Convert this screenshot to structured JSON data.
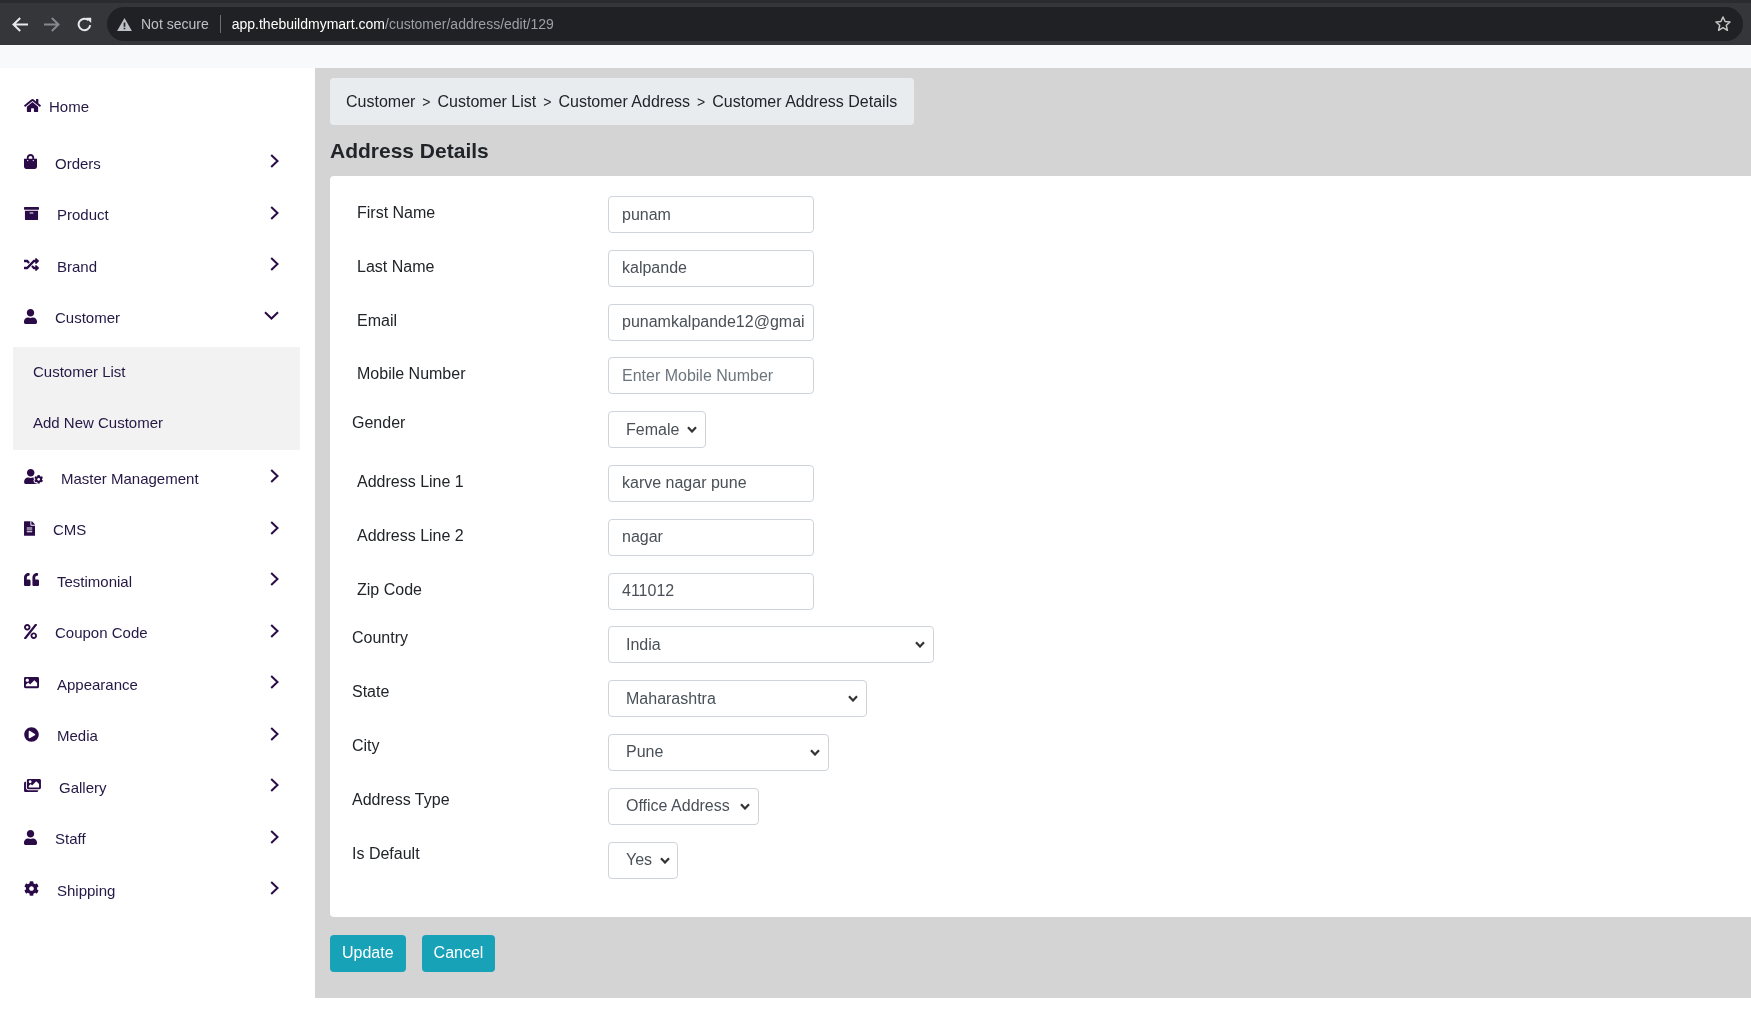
{
  "browser": {
    "security_label": "Not secure",
    "url": {
      "host": "app.thebuildmymart.com",
      "path": "/customer/address/edit/129"
    }
  },
  "sidebar": {
    "items": [
      {
        "label": "Home",
        "kind": "link"
      },
      {
        "label": "Orders",
        "kind": "group",
        "expanded": false
      },
      {
        "label": "Product",
        "kind": "group",
        "expanded": false
      },
      {
        "label": "Brand",
        "kind": "group",
        "expanded": false
      },
      {
        "label": "Customer",
        "kind": "group",
        "expanded": true,
        "children": [
          {
            "label": "Customer List"
          },
          {
            "label": "Add New Customer"
          }
        ]
      },
      {
        "label": "Master Management",
        "kind": "group",
        "expanded": false
      },
      {
        "label": "CMS",
        "kind": "group",
        "expanded": false
      },
      {
        "label": "Testimonial",
        "kind": "group",
        "expanded": false
      },
      {
        "label": "Coupon Code",
        "kind": "group",
        "expanded": false
      },
      {
        "label": "Appearance",
        "kind": "group",
        "expanded": false
      },
      {
        "label": "Media",
        "kind": "group",
        "expanded": false
      },
      {
        "label": "Gallery",
        "kind": "group",
        "expanded": false
      },
      {
        "label": "Staff",
        "kind": "group",
        "expanded": false
      },
      {
        "label": "Shipping",
        "kind": "group",
        "expanded": false
      }
    ]
  },
  "breadcrumb": {
    "items": [
      "Customer",
      "Customer List",
      "Customer Address",
      "Customer Address Details"
    ],
    "separator": ">"
  },
  "page_title": "Address Details",
  "form": {
    "fields": [
      {
        "label": "First Name",
        "kind": "text",
        "value": "punam"
      },
      {
        "label": "Last Name",
        "kind": "text",
        "value": "kalpande"
      },
      {
        "label": "Email",
        "kind": "text",
        "value": "punamkalpande12@gmai"
      },
      {
        "label": "Mobile Number",
        "kind": "text",
        "placeholder": "Enter Mobile Number"
      },
      {
        "label": "Gender",
        "kind": "select",
        "value": "Female"
      },
      {
        "label": "Address Line 1",
        "kind": "text",
        "value": "karve nagar pune"
      },
      {
        "label": "Address Line 2",
        "kind": "text",
        "value": "nagar"
      },
      {
        "label": "Zip Code",
        "kind": "text",
        "value": "411012"
      },
      {
        "label": "Country",
        "kind": "select",
        "value": "India"
      },
      {
        "label": "State",
        "kind": "select",
        "value": "Maharashtra"
      },
      {
        "label": "City",
        "kind": "select",
        "value": "Pune"
      },
      {
        "label": "Address Type",
        "kind": "select",
        "value": "Office Address"
      },
      {
        "label": "Is Default",
        "kind": "select",
        "value": "Yes"
      }
    ]
  },
  "buttons": [
    {
      "label": "Update"
    },
    {
      "label": "Cancel"
    }
  ]
}
